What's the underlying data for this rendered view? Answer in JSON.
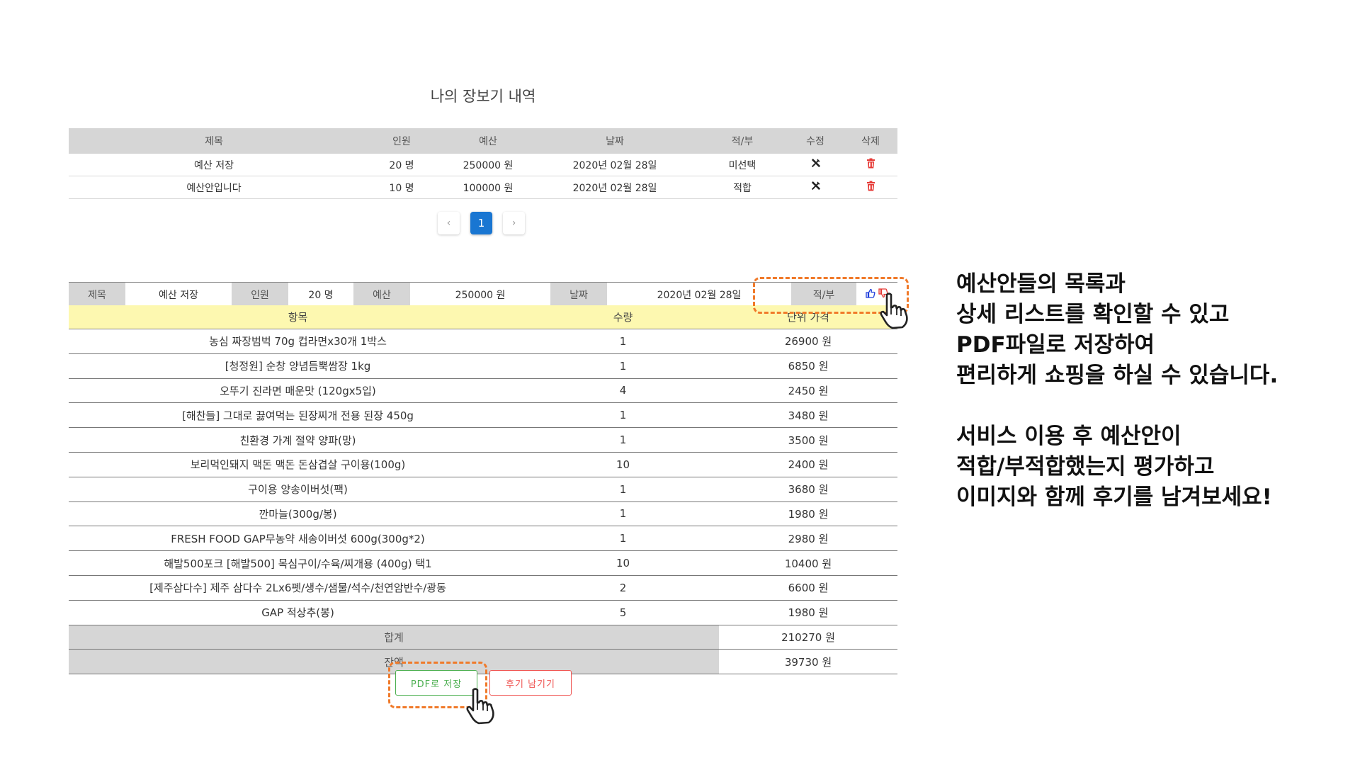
{
  "page_title": "나의 장보기 내역",
  "history": {
    "headers": [
      "제목",
      "인원",
      "예산",
      "날짜",
      "적/부",
      "수정",
      "삭제"
    ],
    "rows": [
      {
        "title": "예산 저장",
        "people": "20 명",
        "budget": "250000 원",
        "date": "2020년 02월 28일",
        "fit": "미선택"
      },
      {
        "title": "예산안입니다",
        "people": "10 명",
        "budget": "100000 원",
        "date": "2020년 02월 28일",
        "fit": "적합"
      }
    ]
  },
  "pagination": {
    "prev": "‹",
    "current": "1",
    "next": "›"
  },
  "detail": {
    "title_label": "제목",
    "title_value": "예산 저장",
    "people_label": "인원",
    "people_value": "20 명",
    "budget_label": "예산",
    "budget_value": "250000 원",
    "date_label": "날짜",
    "date_value": "2020년 02월 28일",
    "fit_label": "적/부",
    "item_headers": [
      "항목",
      "수량",
      "단위 가격"
    ],
    "items": [
      {
        "name": "농심 짜장범벅 70g 컵라면x30개 1박스",
        "qty": "1",
        "price": "26900 원"
      },
      {
        "name": "[청정원] 순창 양념듬뿍쌈장 1kg",
        "qty": "1",
        "price": "6850 원"
      },
      {
        "name": "오뚜기 진라면 매운맛 (120gx5입)",
        "qty": "4",
        "price": "2450 원"
      },
      {
        "name": "[해찬들] 그대로 끓여먹는 된장찌개 전용 된장 450g",
        "qty": "1",
        "price": "3480 원"
      },
      {
        "name": "친환경 가계 절약 양파(망)",
        "qty": "1",
        "price": "3500 원"
      },
      {
        "name": "보리먹인돼지 맥돈 맥돈 돈삼겹살 구이용(100g)",
        "qty": "10",
        "price": "2400 원"
      },
      {
        "name": "구이용 양송이버섯(팩)",
        "qty": "1",
        "price": "3680 원"
      },
      {
        "name": "깐마늘(300g/봉)",
        "qty": "1",
        "price": "1980 원"
      },
      {
        "name": "FRESH FOOD GAP무농약 새송이버섯 600g(300g*2)",
        "qty": "1",
        "price": "2980 원"
      },
      {
        "name": "해발500포크 [해발500] 목심구이/수육/찌개용 (400g) 택1",
        "qty": "10",
        "price": "10400 원"
      },
      {
        "name": "[제주삼다수] 제주 삼다수 2Lx6펫/생수/샘물/석수/천연암반수/광동",
        "qty": "2",
        "price": "6600 원"
      },
      {
        "name": "GAP 적상추(봉)",
        "qty": "5",
        "price": "1980 원"
      }
    ],
    "total_label": "합계",
    "total_value": "210270 원",
    "balance_label": "잔액",
    "balance_value": "39730 원"
  },
  "buttons": {
    "pdf": "PDF로 저장",
    "review": "후기 남기기"
  },
  "annotation": {
    "lines_1": [
      "예산안들의 목록과",
      "상세 리스트를 확인할 수 있고",
      "PDF파일로 저장하여",
      "편리하게 쇼핑을 하실 수 있습니다."
    ],
    "lines_2": [
      "서비스 이용 후 예산안이",
      "적합/부적합했는지 평가하고",
      "이미지와 함께 후기를 남겨보세요!"
    ]
  },
  "colors": {
    "primary": "#1976d2",
    "highlight": "#f07a2a",
    "header_bg": "#d6d6d6",
    "items_header_bg": "#fdf8b0",
    "pdf_green": "#4caf50",
    "review_red": "#ef5350",
    "delete_red": "#e53935",
    "thumb_up_blue": "#1e3ddb",
    "thumb_down_red": "#e53935"
  }
}
